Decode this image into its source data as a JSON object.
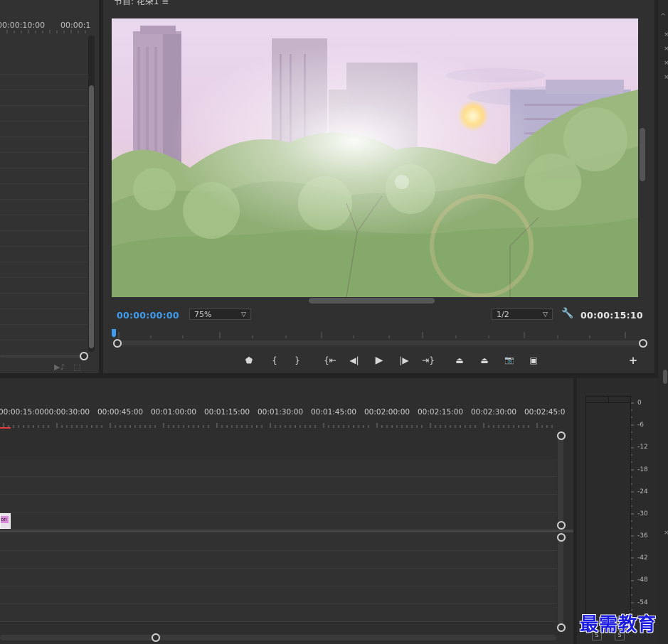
{
  "source_monitor": {
    "timecodes": [
      "00:00:10:00",
      "00:00:1"
    ]
  },
  "program_monitor": {
    "title": "节目: 花朵1 ≡",
    "current_timecode": "00:00:00:00",
    "duration_timecode": "00:00:15:10",
    "zoom_level": "75%",
    "resolution": "1/2",
    "controls": [
      {
        "name": "add-marker-button",
        "icon": "marker-icon",
        "glyph": "⬟"
      },
      {
        "name": "mark-in-button",
        "icon": "mark-in-icon",
        "glyph": "{"
      },
      {
        "name": "mark-out-button",
        "icon": "mark-out-icon",
        "glyph": "}"
      },
      {
        "name": "go-to-in-button",
        "icon": "go-to-in-icon",
        "glyph": "{⇤"
      },
      {
        "name": "step-back-button",
        "icon": "step-back-icon",
        "glyph": "◀|"
      },
      {
        "name": "play-button",
        "icon": "play-icon",
        "glyph": "▶"
      },
      {
        "name": "step-forward-button",
        "icon": "step-forward-icon",
        "glyph": "|▶"
      },
      {
        "name": "go-to-out-button",
        "icon": "go-to-out-icon",
        "glyph": "⇥}"
      },
      {
        "name": "lift-button",
        "icon": "lift-icon",
        "glyph": "⏏"
      },
      {
        "name": "extract-button",
        "icon": "extract-icon",
        "glyph": "⏏"
      },
      {
        "name": "export-frame-button",
        "icon": "camera-icon",
        "glyph": "📷"
      },
      {
        "name": "compare-view-button",
        "icon": "compare-icon",
        "glyph": "▣"
      }
    ],
    "add_button": "+"
  },
  "timeline": {
    "ruler_labels": [
      "00:00:15:00",
      "00:00:30:00",
      "00:00:45:00",
      "00:01:00:00",
      "00:01:15:00",
      "00:01:30:00",
      "00:01:45:00",
      "00:02:00:00",
      "00:02:15:00",
      "00:02:30:00",
      "00:02:45:0"
    ],
    "clip_label": "on"
  },
  "audio_meter": {
    "scale": [
      "0",
      "-6",
      "-12",
      "-18",
      "-24",
      "-30",
      "-36",
      "-42",
      "-48",
      "-54"
    ],
    "solo_labels": [
      "S",
      "S"
    ]
  },
  "watermark": "最需教育",
  "colors": {
    "timecode_blue": "#3e9df0",
    "playhead_red": "#e23a3a",
    "clip_pink": "#d98bd9"
  }
}
